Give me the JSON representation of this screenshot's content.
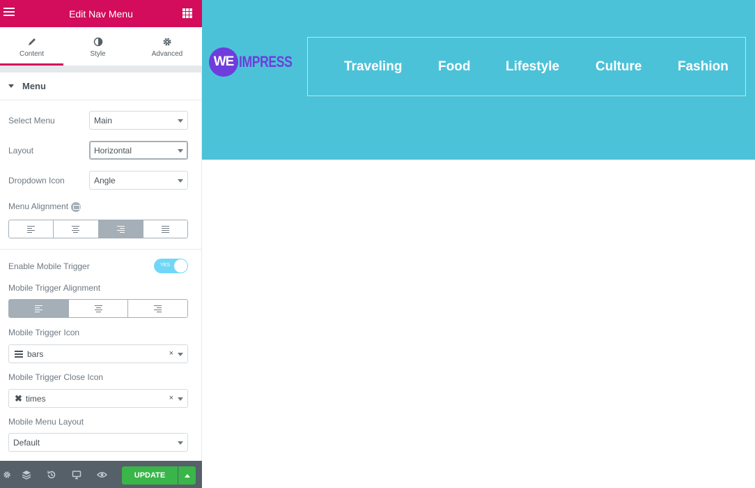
{
  "panel": {
    "title": "Edit Nav Menu",
    "tabs": [
      {
        "label": "Content",
        "icon": "pencil-icon",
        "active": true
      },
      {
        "label": "Style",
        "icon": "half-circle-icon",
        "active": false
      },
      {
        "label": "Advanced",
        "icon": "gear-icon",
        "active": false
      }
    ],
    "section": {
      "label": "Menu"
    },
    "select_menu": {
      "label": "Select Menu",
      "value": "Main"
    },
    "layout": {
      "label": "Layout",
      "value": "Horizontal"
    },
    "dropdown_icon": {
      "label": "Dropdown Icon",
      "value": "Angle"
    },
    "menu_alignment": {
      "label": "Menu Alignment",
      "options": [
        "left",
        "center",
        "right",
        "justify"
      ],
      "selected": "right"
    },
    "enable_mobile_trigger": {
      "label": "Enable Mobile Trigger",
      "state": "YES"
    },
    "mobile_trigger_alignment": {
      "label": "Mobile Trigger Alignment",
      "options": [
        "left",
        "center",
        "right"
      ],
      "selected": "left"
    },
    "mobile_trigger_icon": {
      "label": "Mobile Trigger Icon",
      "value": "bars",
      "clear": "×"
    },
    "mobile_trigger_close_icon": {
      "label": "Mobile Trigger Close Icon",
      "value": "times",
      "clear": "×",
      "glyph": "✖"
    },
    "mobile_menu_layout": {
      "label": "Mobile Menu Layout",
      "value": "Default"
    },
    "footer": {
      "update_label": "UPDATE"
    }
  },
  "preview": {
    "logo": {
      "mark": "WE",
      "word": "IMPRESS"
    },
    "nav": [
      "Traveling",
      "Food",
      "Lifestyle",
      "Culture",
      "Fashion"
    ]
  },
  "colors": {
    "brand": "#d30c5c",
    "hero_bg": "#4cc2d8",
    "logo": "#6f3ddc",
    "update": "#39b54a",
    "footer": "#556068"
  }
}
